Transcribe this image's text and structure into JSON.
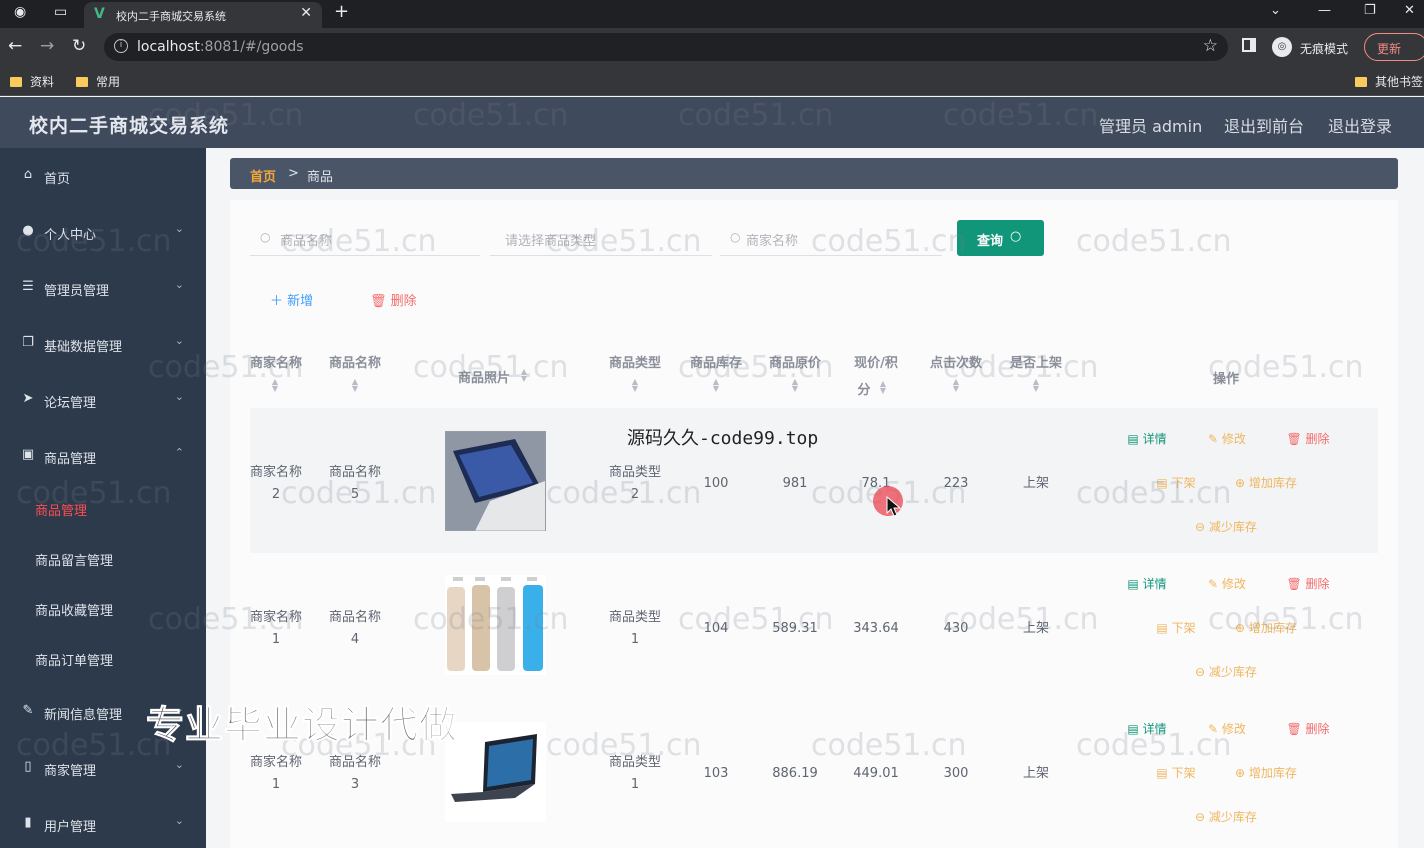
{
  "browser": {
    "tab_title": "校内二手商城交易系统",
    "tab_close": "✕",
    "new_tab": "+",
    "url_host": "localhost",
    "url_rest": ":8081/#/goods",
    "incognito_label": "无痕模式",
    "update_label": "更新",
    "bookmarks": [
      "资料",
      "常用"
    ],
    "other_bookmarks": "其他书签"
  },
  "header": {
    "app_title": "校内二手商城交易系统",
    "admin_label": "管理员 admin",
    "to_front": "退出到前台",
    "logout": "退出登录"
  },
  "sidebar": {
    "items": [
      {
        "label": "首页",
        "icon": "home-icon"
      },
      {
        "label": "个人中心",
        "icon": "user-icon"
      },
      {
        "label": "管理员管理",
        "icon": "list-icon"
      },
      {
        "label": "基础数据管理",
        "icon": "copy-icon"
      },
      {
        "label": "论坛管理",
        "icon": "send-icon"
      },
      {
        "label": "商品管理",
        "icon": "checklist-icon"
      },
      {
        "label": "新闻信息管理",
        "icon": "news-icon"
      },
      {
        "label": "商家管理",
        "icon": "phone-icon"
      },
      {
        "label": "用户管理",
        "icon": "chart-icon"
      }
    ],
    "sub_items": [
      "商品管理",
      "商品留言管理",
      "商品收藏管理",
      "商品订单管理"
    ]
  },
  "breadcrumb": {
    "home": "首页",
    "sep": ">",
    "current": "商品"
  },
  "search": {
    "goods_name_placeholder": "商品名称",
    "goods_type_placeholder": "请选择商品类型",
    "merchant_name_placeholder": "商家名称",
    "query_label": "查询"
  },
  "toolbar": {
    "add_label": "新增",
    "delete_label": "删除"
  },
  "table": {
    "headers": {
      "merchant": "商家名称",
      "goods_name": "商品名称",
      "photo": "商品照片",
      "type": "商品类型",
      "stock": "商品库存",
      "orig_price": "商品原价",
      "price_a": "现价/积",
      "price_b": "分",
      "clicks": "点击次数",
      "on_shelf": "是否上架",
      "actions": "操作"
    },
    "rows": [
      {
        "merchant_a": "商家名称",
        "merchant_b": "2",
        "name_a": "商品名称",
        "name_b": "5",
        "type_a": "商品类型",
        "type_b": "2",
        "stock": "100",
        "orig_price": "981",
        "price": "78.1",
        "clicks": "223",
        "on_shelf": "上架"
      },
      {
        "merchant_a": "商家名称",
        "merchant_b": "1",
        "name_a": "商品名称",
        "name_b": "4",
        "type_a": "商品类型",
        "type_b": "1",
        "stock": "104",
        "orig_price": "589.31",
        "price": "343.64",
        "clicks": "430",
        "on_shelf": "上架"
      },
      {
        "merchant_a": "商家名称",
        "merchant_b": "1",
        "name_a": "商品名称",
        "name_b": "3",
        "type_a": "商品类型",
        "type_b": "1",
        "stock": "103",
        "orig_price": "886.19",
        "price": "449.01",
        "clicks": "300",
        "on_shelf": "上架"
      }
    ],
    "actions": {
      "detail": "详情",
      "edit": "修改",
      "remove": "删除",
      "off": "下架",
      "add_stock": "增加库存",
      "sub_stock": "减少库存"
    }
  },
  "overlays": {
    "watermark": "code51.cn",
    "promo": "专业毕业设计代做",
    "source": "源码久久-code99.top"
  },
  "colors": {
    "accent": "#12967a",
    "danger": "#f56c6c",
    "warning": "#f0b65e",
    "sidebar": "#2d3a4b",
    "header": "#3f4a5c"
  }
}
